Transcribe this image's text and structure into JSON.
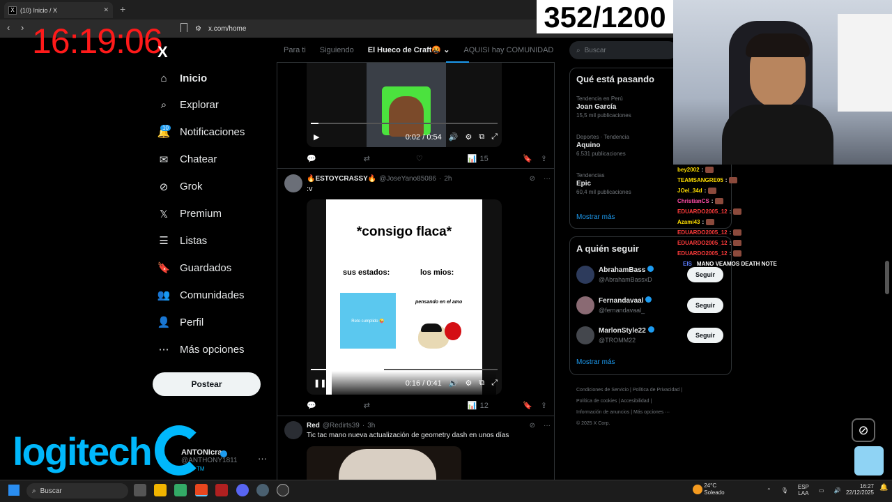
{
  "browser": {
    "tab_title": "(10) Inicio / X",
    "tab_icon": "X",
    "url": "x.com/home"
  },
  "overlay": {
    "timer": "16:19:06",
    "counter": "352/1200"
  },
  "nav": {
    "logo": "X",
    "notif_badge": "10",
    "items": [
      {
        "label": "Inicio",
        "icon": "home-icon"
      },
      {
        "label": "Explorar",
        "icon": "search-icon"
      },
      {
        "label": "Notificaciones",
        "icon": "bell-icon"
      },
      {
        "label": "Chatear",
        "icon": "mail-icon"
      },
      {
        "label": "Grok",
        "icon": "grok-icon"
      },
      {
        "label": "Premium",
        "icon": "x-icon"
      },
      {
        "label": "Listas",
        "icon": "list-icon"
      },
      {
        "label": "Guardados",
        "icon": "bookmark-icon"
      },
      {
        "label": "Comunidades",
        "icon": "people-icon"
      },
      {
        "label": "Perfil",
        "icon": "user-icon"
      },
      {
        "label": "Más opciones",
        "icon": "more-icon"
      }
    ],
    "post_button": "Postear",
    "account_name": "ANTONIcra",
    "account_handle": "@ANTHONY1811"
  },
  "logitech": {
    "text": "logitech",
    "tm": "TM"
  },
  "feed": {
    "tabs": [
      "Para ti",
      "Siguiendo",
      "El Hueco de Craft🤬",
      "AQUISI hay COMUNIDAD"
    ],
    "tweet1": {
      "video_time": "0:02 / 0:54",
      "views": "15",
      "progress": 0.04
    },
    "tweet2": {
      "name": "🔥ESTOYCRASSY🔥",
      "handle": "@JoseYano85086",
      "time": "2h",
      "text": ":v",
      "meme_title": "*consigo flaca*",
      "left_label": "sus estados:",
      "right_label": "los mios:",
      "card_text": "Reto cumplido 😜",
      "caption": "pensando en el amo",
      "video_time": "0:16 / 0:41",
      "views": "12",
      "progress": 0.39
    },
    "tweet3": {
      "name": "Red",
      "handle": "@Redirts39",
      "time": "3h",
      "text": "Tic tac mano nueva actualización de geometry dash en unos días"
    }
  },
  "right": {
    "search_placeholder": "Buscar",
    "trends_title": "Qué está pasando",
    "trends": [
      {
        "context": "Tendencia en Perú",
        "name": "Joan García",
        "count": "15,5 mil publicaciones"
      },
      {
        "context": "Deportes · Tendencia",
        "name": "Aquino",
        "count": "6.531 publicaciones"
      },
      {
        "context": "Tendencias",
        "name": "Epic",
        "count": "60,4 mil publicaciones"
      }
    ],
    "show_more": "Mostrar más",
    "follow_title": "A quién seguir",
    "follow": [
      {
        "name": "AbrahamBass",
        "handle": "@AbrahamBassxD"
      },
      {
        "name": "Fernandavaal",
        "handle": "@fernandavaal_"
      },
      {
        "name": "MarlonStyle22",
        "handle": "@TROMM22"
      }
    ],
    "follow_button": "Seguir",
    "footer": [
      "Condiciones de Servicio",
      "Política de Privacidad",
      "Política de cookies",
      "Accesibilidad",
      "Información de anuncios",
      "Más opciones ···",
      "© 2025 X Corp."
    ]
  },
  "chat": [
    {
      "user": "bey2002",
      "color": "#ffde00"
    },
    {
      "user": "TEAMSANGRE05",
      "color": "#ffde00"
    },
    {
      "user": "JOel_34d",
      "color": "#ffde00"
    },
    {
      "user": "ChristianCS",
      "color": "#ff4da6"
    },
    {
      "user": "EDUARDO2005_12",
      "color": "#ff3b3b"
    },
    {
      "user": "Azami43",
      "color": "#ffde00"
    },
    {
      "user": "EDUARDO2005_12",
      "color": "#ff3b3b"
    },
    {
      "user": "EDUARDO2005_12",
      "color": "#ff3b3b"
    },
    {
      "user": "EDUARDO2005_12",
      "color": "#ff3b3b"
    }
  ],
  "chat_last": "MANO VEAMOS DEATH NOTE",
  "chat_last_user": "EIS",
  "taskbar": {
    "search": "Buscar",
    "temp": "24°C",
    "weather": "Soleado",
    "lang1": "ESP",
    "lang2": "LAA",
    "time": "16:27",
    "date": "22/12/2025"
  }
}
